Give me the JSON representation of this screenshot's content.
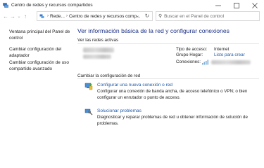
{
  "window": {
    "title": "Centro de redes y recursos compartidos"
  },
  "address": {
    "breadcrumbs": [
      "Rede...",
      "Centro de redes y recursos comp..."
    ]
  },
  "search": {
    "placeholder": "Buscar en el Panel de control"
  },
  "sidebar": {
    "items": [
      {
        "label": "Ventana principal del Panel de control"
      },
      {
        "label": "Cambiar configuración del adaptador"
      },
      {
        "label": "Cambiar configuración de uso compartido avanzado"
      }
    ]
  },
  "main": {
    "heading": "Ver información básica de la red y configurar conexiones",
    "active_networks_label": "Ver las redes activas",
    "access_type_label": "Tipo de acceso:",
    "access_type_value": "Internet",
    "homegroup_label": "Grupo Hogar:",
    "homegroup_value": "Listo para crear",
    "connections_label": "Conexiones:",
    "change_settings_label": "Cambiar la configuración de red",
    "tasks": [
      {
        "title": "Configurar una nueva conexión o red",
        "description": "Configurar una conexión de banda ancha, de acceso telefónico o VPN; o bien configurar un enrutador o punto de acceso."
      },
      {
        "title": "Solucionar problemas",
        "description": "Diagnosticar y reparar problemas de red u obtener información de solución de problemas."
      }
    ]
  },
  "colors": {
    "heading": "#1e3287",
    "link": "#1e5aa8"
  }
}
